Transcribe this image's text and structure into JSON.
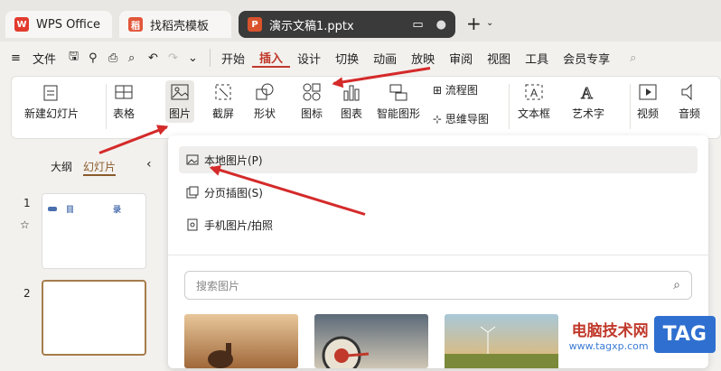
{
  "tabs": [
    {
      "label": "WPS Office",
      "logo": "W"
    },
    {
      "label": "找稻壳模板",
      "logo": "稻"
    },
    {
      "label": "演示文稿1.pptx",
      "logo": "P"
    }
  ],
  "menu": {
    "file": "文件",
    "items": [
      "开始",
      "插入",
      "设计",
      "切换",
      "动画",
      "放映",
      "审阅",
      "视图",
      "工具",
      "会员专享"
    ]
  },
  "ribbon": {
    "new_slide": "新建幻灯片",
    "table": "表格",
    "picture": "图片",
    "screenshot": "截屏",
    "shape": "形状",
    "icon": "图标",
    "chart": "图表",
    "smartart": "智能图形",
    "flowchart": "流程图",
    "mindmap": "思维导图",
    "textbox": "文本框",
    "wordart": "艺术字",
    "video": "视频",
    "audio": "音频"
  },
  "sidebar": {
    "outline": "大纲",
    "slides": "幻灯片",
    "slide_numbers": [
      "1",
      "2"
    ],
    "slide1_left": "目",
    "slide1_right": "录"
  },
  "dropdown": {
    "items": [
      "本地图片(P)",
      "分页插图(S)",
      "手机图片/拍照"
    ],
    "search_placeholder": "搜索图片"
  },
  "watermark": {
    "site": "电脑技术网",
    "url": "www.tagxp.com",
    "badge": "TAG"
  },
  "colors": {
    "accent": "#c0392b",
    "annotation": "#d42a2a"
  }
}
